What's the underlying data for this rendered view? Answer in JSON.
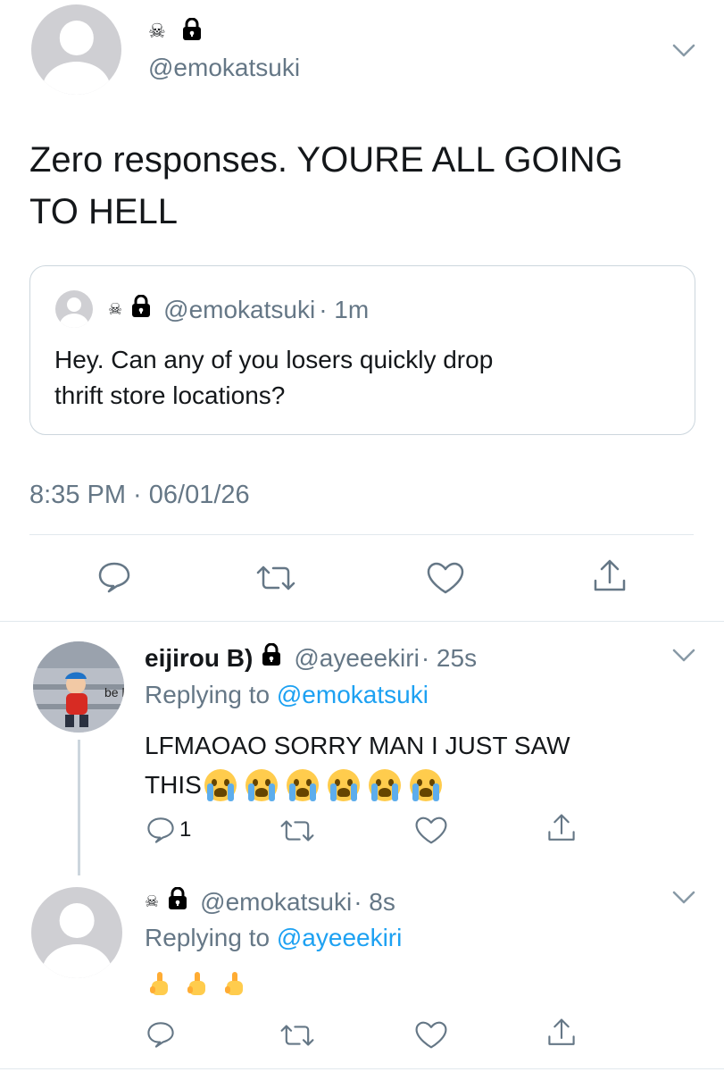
{
  "main_tweet": {
    "emoji_icons": "☠",
    "handle": "@emokatsuki",
    "text_line1": "Zero responses. YOURE ALL GOING",
    "text_line2": "TO HELL",
    "timestamp": "8:35 PM · 06/01/26"
  },
  "quoted_tweet": {
    "skull": "☠",
    "handle": "@emokatsuki",
    "time": "· 1m",
    "text_line1": "Hey. Can any of you losers quickly drop",
    "text_line2": "thrift store locations?"
  },
  "reply1": {
    "name": "eijirou B)",
    "handle": "@ayeeekiri",
    "time": "· 25s",
    "replying_prefix": "Replying to",
    "replying_to": "@emokatsuki",
    "text_line1": "LFMAOAO SORRY MAN I JUST SAW",
    "text_line2": "THIS",
    "reply_count": "1"
  },
  "reply2": {
    "skull": "☠",
    "handle": "@emokatsuki",
    "time": "· 8s",
    "replying_prefix": "Replying to",
    "replying_to": "@ayeeekiri"
  },
  "colors": {
    "accent": "#1da1f2",
    "secondary_text": "#657786",
    "divider": "#e1e8ed"
  },
  "icons": [
    "skull-emoji",
    "lock-icon",
    "chevron-down-icon",
    "reply-icon",
    "retweet-icon",
    "like-icon",
    "share-icon",
    "crying-face-emoji",
    "middle-finger-emoji"
  ]
}
